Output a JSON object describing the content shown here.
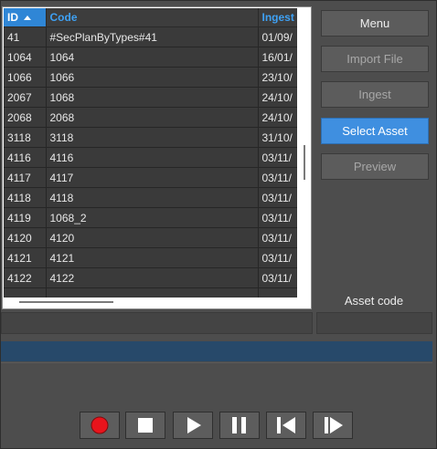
{
  "grid": {
    "columns": [
      "ID",
      "Code",
      "Ingest"
    ],
    "rows": [
      [
        "41",
        "#SecPlanByTypes#41",
        "01/09/"
      ],
      [
        "1064",
        "1064",
        "16/01/"
      ],
      [
        "1066",
        "1066",
        "23/10/"
      ],
      [
        "2067",
        "1068",
        "24/10/"
      ],
      [
        "2068",
        "2068",
        "24/10/"
      ],
      [
        "3118",
        "3118",
        "31/10/"
      ],
      [
        "4116",
        "4116",
        "03/11/"
      ],
      [
        "4117",
        "4117",
        "03/11/"
      ],
      [
        "4118",
        "4118",
        "03/11/"
      ],
      [
        "4119",
        "1068_2",
        "03/11/"
      ],
      [
        "4120",
        "4120",
        "03/11/"
      ],
      [
        "4121",
        "4121",
        "03/11/"
      ],
      [
        "4122",
        "4122",
        "03/11/"
      ],
      [
        "",
        "",
        ""
      ]
    ]
  },
  "side": {
    "menu": "Menu",
    "import_file": "Import File",
    "ingest": "Ingest",
    "select_asset": "Select Asset",
    "preview": "Preview",
    "asset_code_label": "Asset code"
  },
  "icons": {
    "record": "record-icon",
    "stop": "stop-icon",
    "play": "play-icon",
    "pause": "pause-icon",
    "step_back": "step-back-icon",
    "step_forward": "step-forward-icon"
  },
  "colors": {
    "accent": "#3f8fe0",
    "record_red": "#e8141c",
    "header_text": "#3ea1f4",
    "status_bar": "#27496a"
  }
}
